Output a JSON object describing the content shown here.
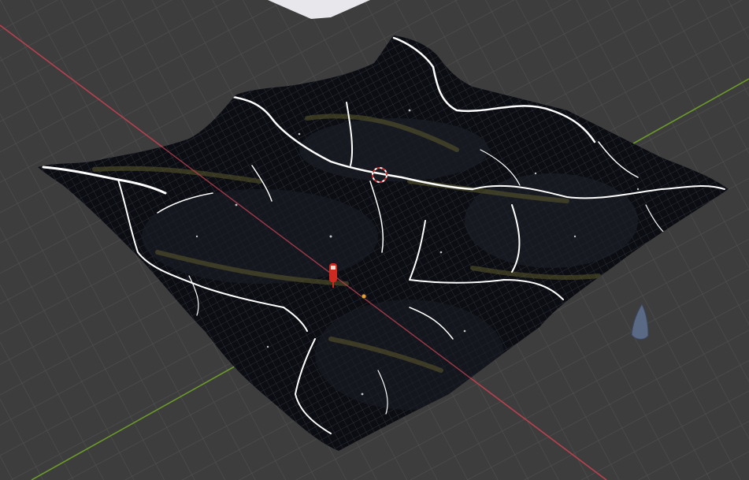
{
  "viewport": {
    "kind": "3d-viewport",
    "background_color": "#3d3d3d",
    "grid_color": "#4a4a4a",
    "x_axis_color": "#b8404f",
    "y_axis_color": "#6b9a2a"
  },
  "scene": {
    "objects": [
      {
        "name": "terrain-mesh",
        "color": "#0d0f14",
        "highlight_color": "#ffffff",
        "mid_color": "#5c5a2c"
      },
      {
        "name": "reference-plane",
        "color": "#e8e8ec"
      },
      {
        "name": "camera-gizmo",
        "color": "#5a6a85"
      },
      {
        "name": "light-gizmo",
        "color": "#cc2a20"
      },
      {
        "name": "3d-cursor",
        "color": "#d8d8d8"
      },
      {
        "name": "object-origin",
        "color": "#f0a030"
      }
    ]
  }
}
